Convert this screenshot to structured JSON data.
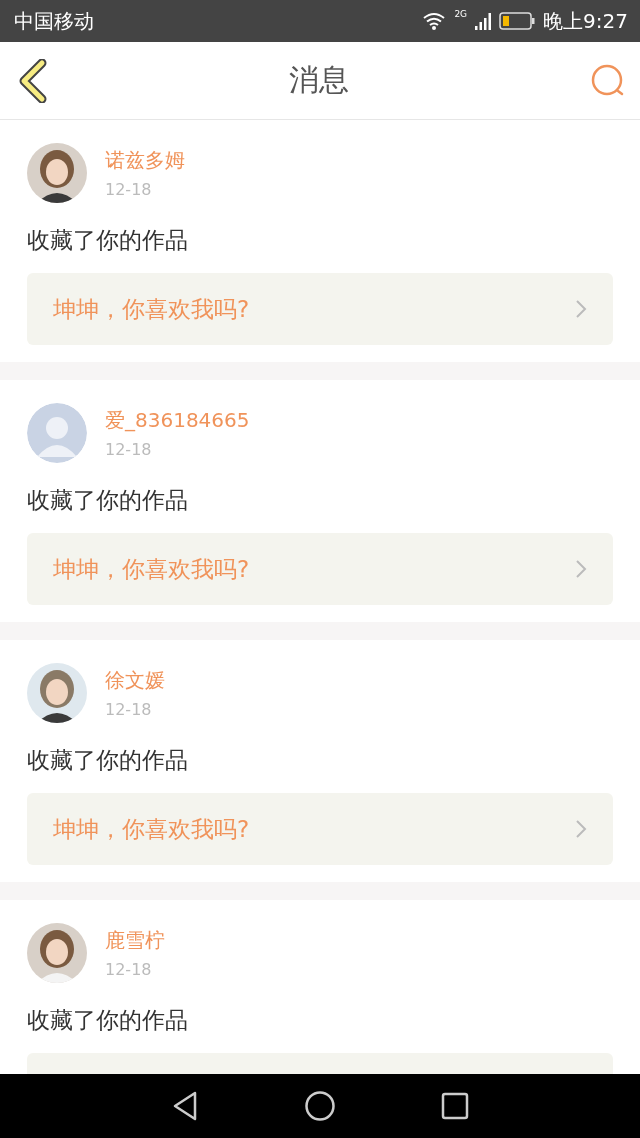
{
  "status_bar": {
    "carrier": "中国移动",
    "network": "2G",
    "time": "晚上9:27"
  },
  "header": {
    "title": "消息"
  },
  "messages": [
    {
      "user": "诺兹多姆",
      "date": "12-18",
      "action": "收藏了你的作品",
      "work": "坤坤，你喜欢我吗?"
    },
    {
      "user": "爱_836184665",
      "kind": "default",
      "date": "12-18",
      "action": "收藏了你的作品",
      "work": "坤坤，你喜欢我吗?"
    },
    {
      "user": "徐文媛",
      "date": "12-18",
      "action": "收藏了你的作品",
      "work": "坤坤，你喜欢我吗?"
    },
    {
      "user": "鹿雪柠",
      "date": "12-18",
      "action": "收藏了你的作品"
    }
  ]
}
